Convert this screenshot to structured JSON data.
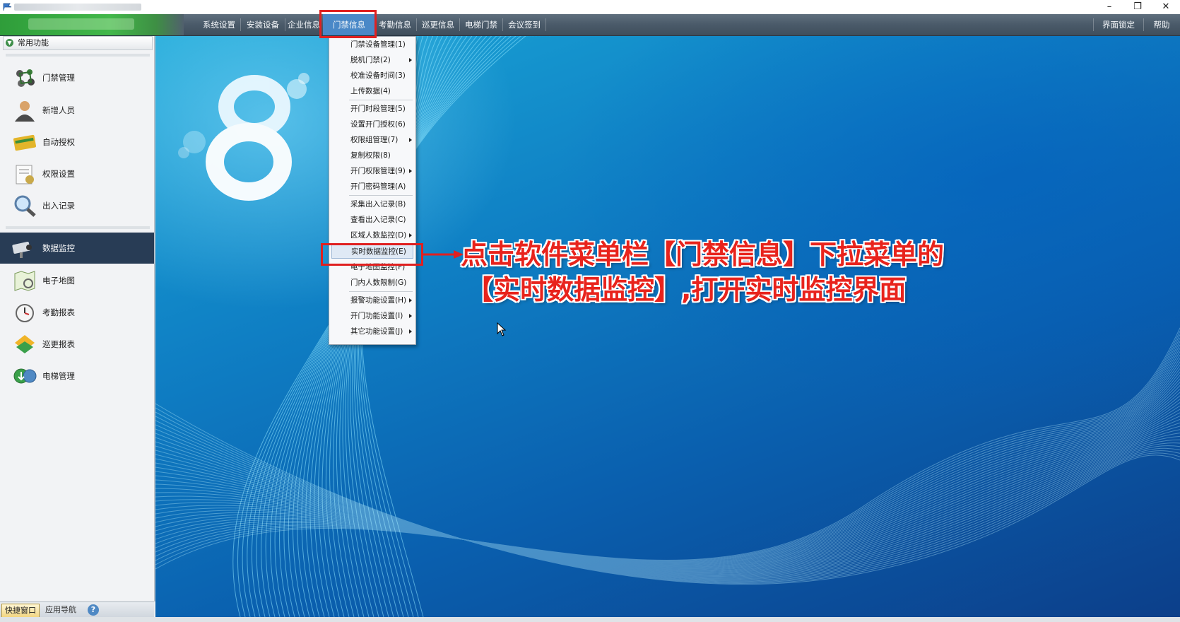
{
  "window": {
    "controls": [
      "–",
      "❐",
      "✕"
    ]
  },
  "menubar": {
    "items": [
      "系统设置",
      "安装设备",
      "企业信息",
      "门禁信息",
      "考勤信息",
      "巡更信息",
      "电梯门禁",
      "会议签到"
    ],
    "active": "门禁信息",
    "right_items": [
      "界面锁定",
      "帮助"
    ]
  },
  "sidebar": {
    "header": "常用功能",
    "items": [
      {
        "label": "门禁管理",
        "icon": "door-control-icon"
      },
      {
        "label": "新增人员",
        "icon": "person-icon"
      },
      {
        "label": "自动授权",
        "icon": "card-icon"
      },
      {
        "label": "权限设置",
        "icon": "permission-icon"
      },
      {
        "label": "出入记录",
        "icon": "magnifier-icon"
      },
      {
        "label": "数据监控",
        "icon": "camera-icon"
      },
      {
        "label": "电子地图",
        "icon": "map-icon"
      },
      {
        "label": "考勤报表",
        "icon": "clock-icon"
      },
      {
        "label": "巡更报表",
        "icon": "patrol-icon"
      },
      {
        "label": "电梯管理",
        "icon": "elevator-icon"
      }
    ],
    "selected": "数据监控"
  },
  "bottom_tabs": [
    "快捷窗口",
    "应用导航"
  ],
  "dropdown": {
    "items": [
      {
        "label": "门禁设备管理(1)",
        "submenu": false
      },
      {
        "label": "脱机门禁(2)",
        "submenu": true
      },
      {
        "label": "校准设备时间(3)",
        "submenu": false
      },
      {
        "label": "上传数据(4)",
        "submenu": false
      },
      {
        "label": "开门时段管理(5)",
        "submenu": false
      },
      {
        "label": "设置开门授权(6)",
        "submenu": false
      },
      {
        "label": "权限组管理(7)",
        "submenu": true
      },
      {
        "label": "复制权限(8)",
        "submenu": false
      },
      {
        "label": "开门权限管理(9)",
        "submenu": true
      },
      {
        "label": "开门密码管理(A)",
        "submenu": false
      },
      {
        "label": "采集出入记录(B)",
        "submenu": false
      },
      {
        "label": "查看出入记录(C)",
        "submenu": false
      },
      {
        "label": "区域人数监控(D)",
        "submenu": true
      },
      {
        "label": "实时数据监控(E)",
        "submenu": false
      },
      {
        "label": "电子地图监控(F)",
        "submenu": false
      },
      {
        "label": "门内人数限制(G)",
        "submenu": false
      },
      {
        "label": "报警功能设置(H)",
        "submenu": true
      },
      {
        "label": "开门功能设置(I)",
        "submenu": true
      },
      {
        "label": "其它功能设置(J)",
        "submenu": true
      }
    ],
    "highlighted": "实时数据监控(E)"
  },
  "annotation": {
    "line1": "点击软件菜单栏【门禁信息】下拉菜单的",
    "line2": "【实时数据监控】,打开实时监控界面",
    "color": "#e8231c"
  },
  "colors": {
    "accent": "#4a88c7",
    "selected_sidebar": "#283c55",
    "annotation_red": "#e02020"
  }
}
